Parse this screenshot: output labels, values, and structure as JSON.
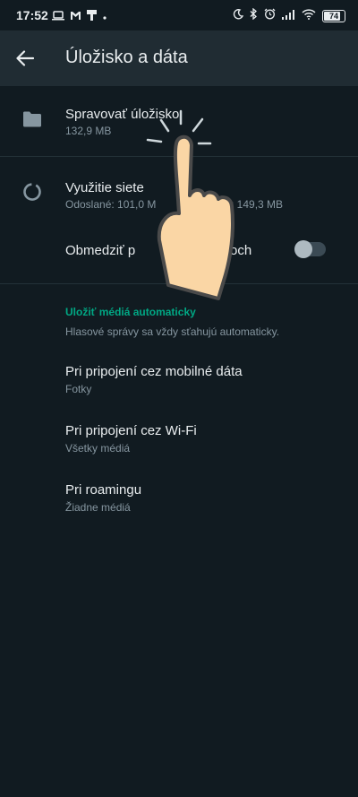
{
  "status_bar": {
    "time": "17:52",
    "battery": "74",
    "left_icons": [
      "laptop-icon",
      "gmail-icon",
      "tool-icon",
      "dot-icon"
    ],
    "right_icons": [
      "moon-icon",
      "bluetooth-icon",
      "alarm-icon",
      "signal-icon",
      "wifi-icon",
      "battery-icon"
    ]
  },
  "app_bar": {
    "title": "Úložisko a dáta",
    "back_icon": "arrow-back-icon"
  },
  "storage": {
    "title": "Spravovať úložisko",
    "subtitle": "132,9 MB",
    "icon": "folder-icon"
  },
  "network": {
    "title": "Využitie siete",
    "subtitle_part1": "Odoslané: 101,0 M",
    "subtitle_part2": "ijaté: 149,3 MB",
    "icon": "data-usage-icon"
  },
  "limit_setting": {
    "title_part1": "Obmedziť p",
    "title_part2": "roch",
    "toggle_on": false
  },
  "auto_download": {
    "section_title": "Uložiť médiá automaticky",
    "description": "Hlasové správy sa vždy sťahujú automaticky.",
    "items": [
      {
        "title": "Pri pripojení cez mobilné dáta",
        "subtitle": "Fotky"
      },
      {
        "title": "Pri pripojení cez Wi-Fi",
        "subtitle": "Všetky médiá"
      },
      {
        "title": "Pri roamingu",
        "subtitle": "Žiadne médiá"
      }
    ]
  },
  "colors": {
    "background": "#111b21",
    "app_bar": "#202c33",
    "accent": "#00a884",
    "text_primary": "#e9edef",
    "text_secondary": "#8696a0"
  },
  "overlay": {
    "icon": "pointing-hand-icon"
  }
}
